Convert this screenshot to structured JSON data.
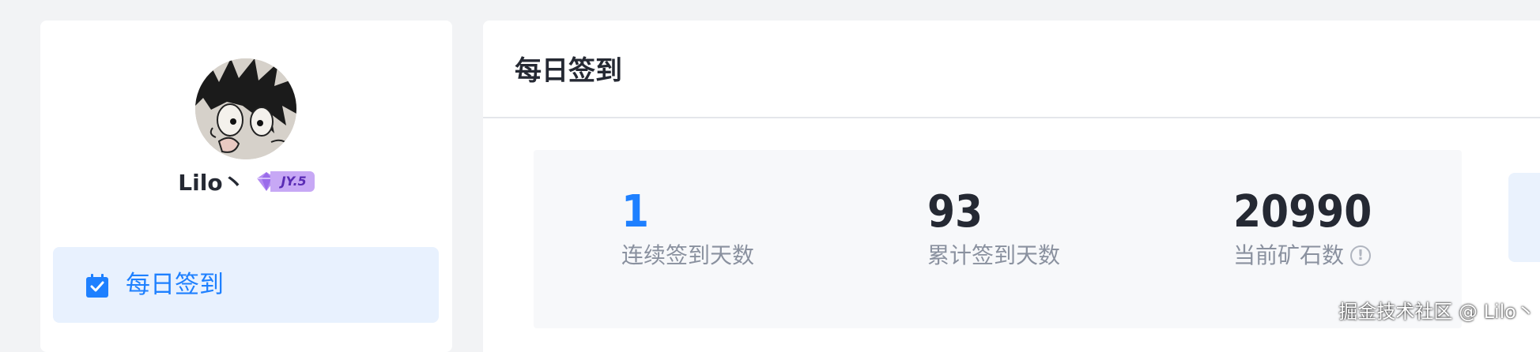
{
  "sidebar": {
    "username": "Lilo丶",
    "level_badge": "JY.5",
    "menu": [
      {
        "label": "每日签到",
        "icon": "calendar-check-icon",
        "active": true
      }
    ]
  },
  "main": {
    "title": "每日签到",
    "stats": [
      {
        "value": "1",
        "label": "连续签到天数"
      },
      {
        "value": "93",
        "label": "累计签到天数"
      },
      {
        "value": "20990",
        "label": "当前矿石数",
        "icon": "info-icon"
      }
    ]
  },
  "watermark": "掘金技术社区 @ Lilo丶",
  "colors": {
    "accent": "#1e80ff",
    "active_bg": "#e8f1fe",
    "text_primary": "#252933",
    "text_secondary": "#8a919f",
    "page_bg": "#f2f3f5",
    "badge_bg": "#c7a8f5"
  }
}
